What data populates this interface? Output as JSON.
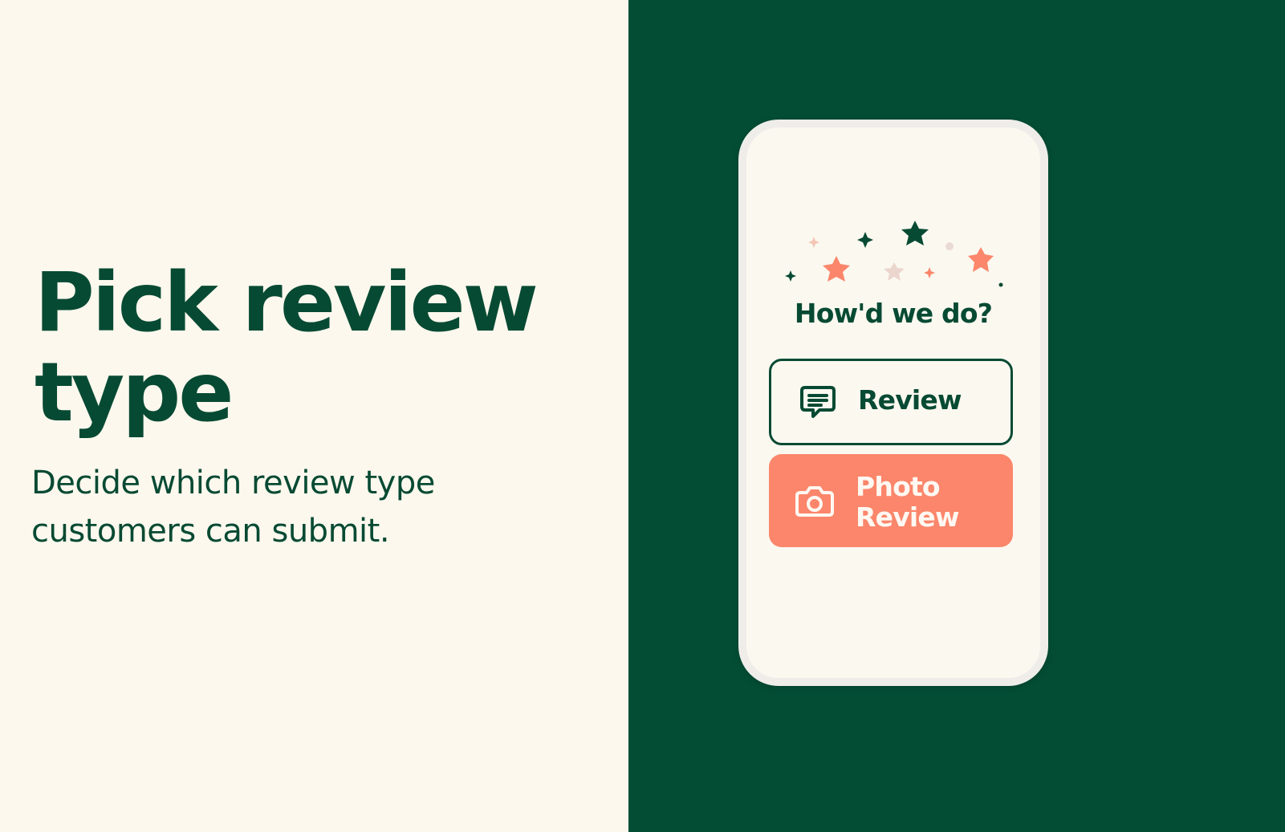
{
  "marketing": {
    "title": "Pick review type",
    "description": "Decide which review type customers can submit."
  },
  "phone": {
    "question": "How'd we do?",
    "buttons": {
      "review_label": "Review",
      "photo_review_label": "Photo Review"
    }
  },
  "icons": {
    "review": "speech-bubble-icon",
    "photo_review": "camera-icon",
    "decorations": "star-sparkle-icons"
  },
  "colors": {
    "cream": "#fdf8ee",
    "forest_green": "#034d35",
    "text_green": "#074a33",
    "coral": "#fb866b",
    "phone_frame": "#eeede9"
  }
}
